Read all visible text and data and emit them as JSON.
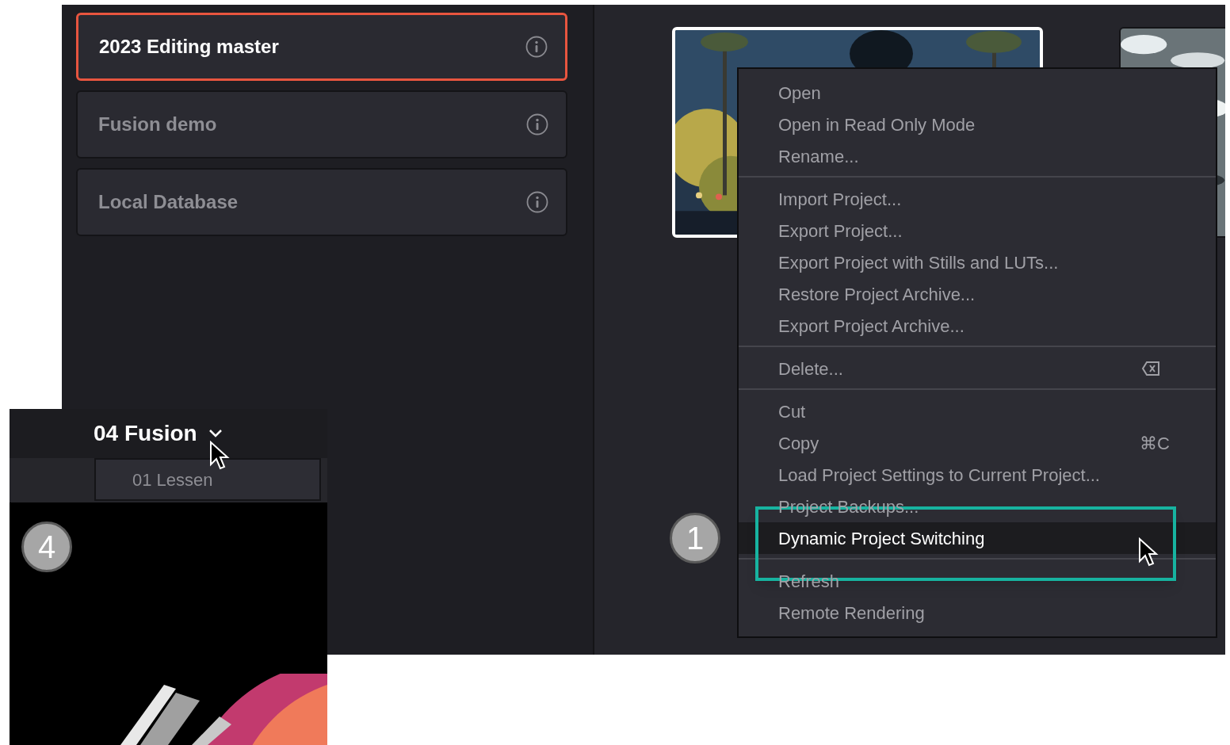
{
  "projects": [
    {
      "name": "2023 Editing master",
      "selected": true
    },
    {
      "name": "Fusion demo",
      "selected": false
    },
    {
      "name": "Local Database",
      "selected": false
    }
  ],
  "thumbnails": [
    {
      "selected": true
    },
    {
      "selected": false
    }
  ],
  "context_menu": {
    "groups": [
      [
        {
          "label": "Open",
          "selected": false
        },
        {
          "label": "Open in Read Only Mode",
          "selected": false
        },
        {
          "label": "Rename...",
          "selected": false
        }
      ],
      [
        {
          "label": "Import Project...",
          "selected": false
        },
        {
          "label": "Export Project...",
          "selected": false
        },
        {
          "label": "Export Project with Stills and LUTs...",
          "selected": false
        },
        {
          "label": "Restore Project Archive...",
          "selected": false
        },
        {
          "label": "Export Project Archive...",
          "selected": false
        }
      ],
      [
        {
          "label": "Delete...",
          "selected": false,
          "has_icon": true
        }
      ],
      [
        {
          "label": "Cut",
          "selected": false
        },
        {
          "label": "Copy",
          "selected": false,
          "shortcut": "⌘C"
        },
        {
          "label": "Load Project Settings to Current Project...",
          "selected": false
        },
        {
          "label": "Project Backups...",
          "selected": false
        },
        {
          "label": "Dynamic Project Switching",
          "selected": true
        }
      ],
      [
        {
          "label": "Refresh",
          "selected": false
        },
        {
          "label": "Remote Rendering",
          "selected": false
        }
      ]
    ]
  },
  "annotations": [
    {
      "number": "4"
    },
    {
      "number": "1"
    }
  ],
  "inset": {
    "title": "04 Fusion",
    "dropdown_item": "01 Lessen"
  }
}
